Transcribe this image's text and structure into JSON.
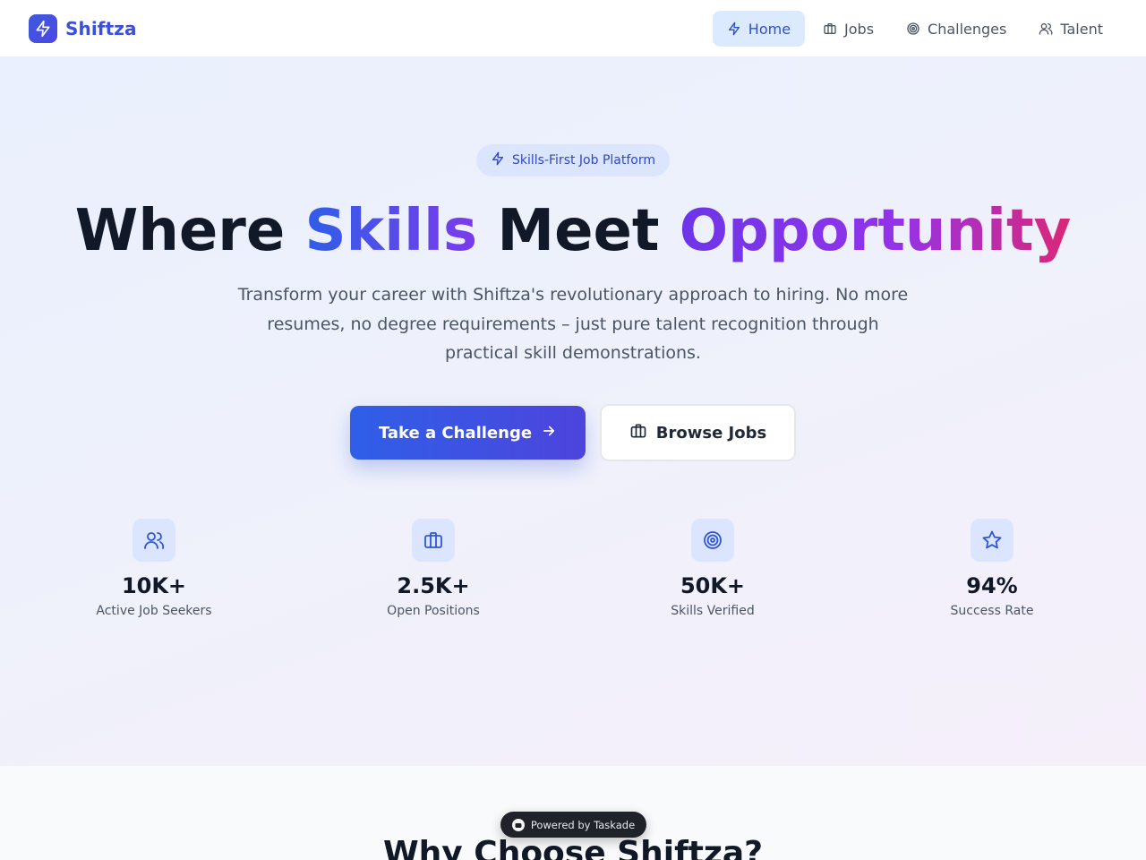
{
  "brand": {
    "name": "Shiftza",
    "logo_icon": "lightning-icon",
    "accent_color": "#3b4fd8"
  },
  "nav": {
    "items": [
      {
        "label": "Home",
        "icon": "lightning-icon",
        "active": true
      },
      {
        "label": "Jobs",
        "icon": "briefcase-icon",
        "active": false
      },
      {
        "label": "Challenges",
        "icon": "target-icon",
        "active": false
      },
      {
        "label": "Talent",
        "icon": "user-icon",
        "active": false
      }
    ]
  },
  "hero": {
    "badge": "Skills-First Job Platform",
    "title_part1": "Where ",
    "title_part2": "Skills",
    "title_part3": " Meet ",
    "title_part4": "Opportunity",
    "subtitle": "Transform your career with Shiftza's revolutionary approach to hiring. No more resumes, no degree requirements – just pure talent recognition through practical skill demonstrations.",
    "primary_cta": "Take a Challenge",
    "secondary_cta": "Browse Jobs"
  },
  "stats": [
    {
      "value": "10K+",
      "label": "Active Job Seekers",
      "icon": "users-icon"
    },
    {
      "value": "2.5K+",
      "label": "Open Positions",
      "icon": "briefcase-icon"
    },
    {
      "value": "50K+",
      "label": "Skills Verified",
      "icon": "target-icon"
    },
    {
      "value": "94%",
      "label": "Success Rate",
      "icon": "star-icon"
    }
  ],
  "why_section": {
    "title": "Why Choose Shiftza?"
  },
  "powered_by": "Powered by Taskade"
}
